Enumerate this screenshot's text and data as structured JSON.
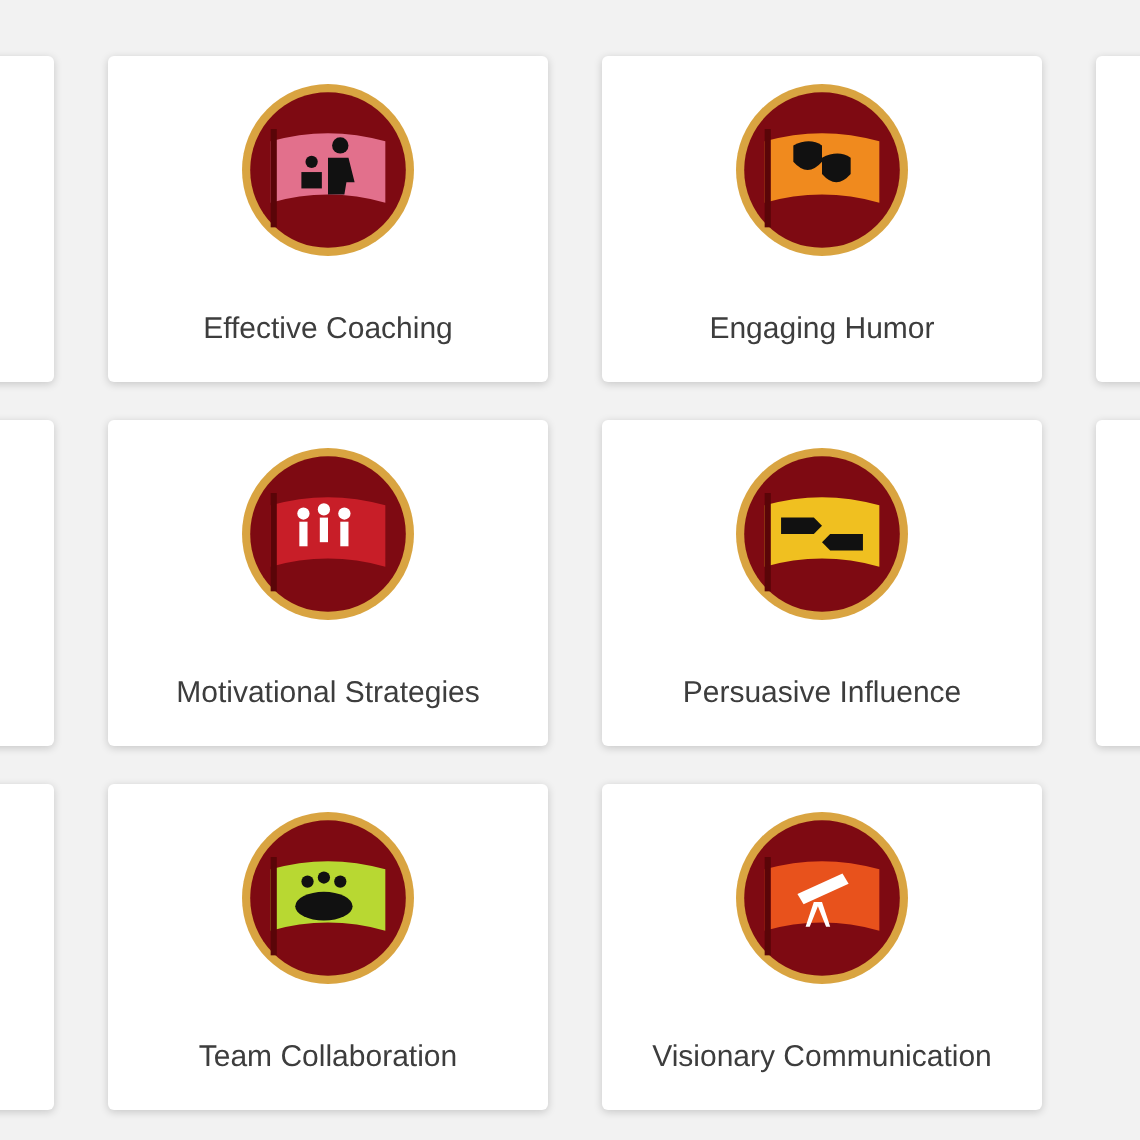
{
  "rows": [
    {
      "cards": [
        {
          "kind": "blank"
        },
        {
          "kind": "badge",
          "label": "Effective Coaching",
          "color": "#e2708c"
        },
        {
          "kind": "badge",
          "label": "Engaging Humor",
          "color": "#f08a1e"
        },
        {
          "kind": "blank"
        }
      ]
    },
    {
      "cards": [
        {
          "kind": "blank"
        },
        {
          "kind": "badge",
          "label": "Motivational Strategies",
          "color": "#c81e28"
        },
        {
          "kind": "badge",
          "label": "Persuasive Influence",
          "color": "#f0c020"
        },
        {
          "kind": "blank"
        }
      ]
    },
    {
      "cards": [
        {
          "kind": "blank"
        },
        {
          "kind": "badge",
          "label": "Team Collaboration",
          "color": "#b8d832"
        },
        {
          "kind": "badge",
          "label": "Visionary Communication",
          "color": "#e8521c"
        }
      ]
    }
  ]
}
